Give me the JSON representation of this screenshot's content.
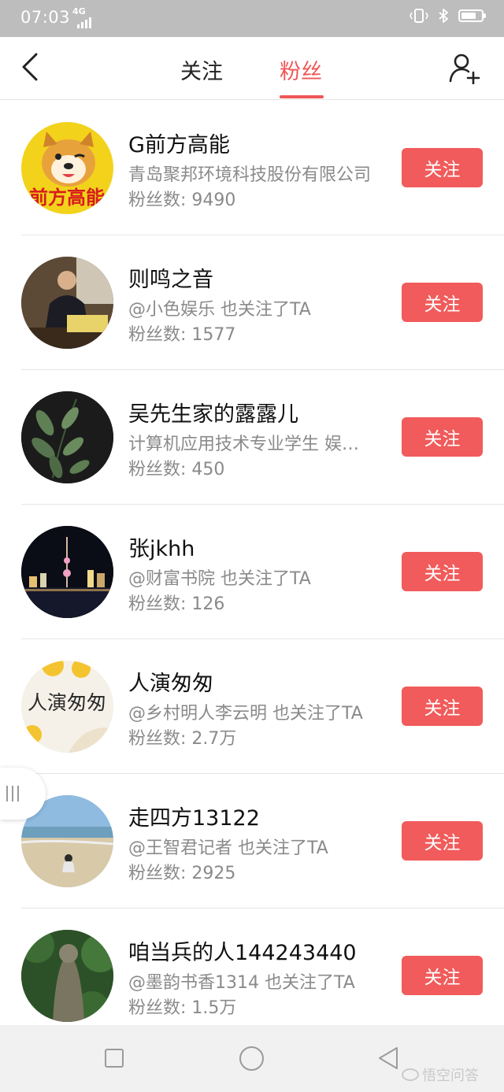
{
  "status": {
    "time": "07:03",
    "network": "4G",
    "battery_level": 0.75
  },
  "header": {
    "tabs": [
      {
        "label": "关注",
        "active": false
      },
      {
        "label": "粉丝",
        "active": true
      }
    ],
    "accent": "#f05656"
  },
  "follow_label": "关注",
  "users": [
    {
      "name": "G前方高能",
      "desc": "青岛聚邦环境科技股份有限公司",
      "fans": "粉丝数: 9490"
    },
    {
      "name": "则鸣之音",
      "desc": "@小色娱乐 也关注了TA",
      "fans": "粉丝数: 1577"
    },
    {
      "name": "吴先生家的露露儿",
      "desc": "计算机应用技术专业学生 娱乐达人",
      "fans": "粉丝数: 450"
    },
    {
      "name": "张jkhh",
      "desc": "@财富书院 也关注了TA",
      "fans": "粉丝数: 126"
    },
    {
      "name": "人演匆匆",
      "desc": "@乡村明人李云明 也关注了TA",
      "fans": "粉丝数: 2.7万"
    },
    {
      "name": "走四方13122",
      "desc": "@王智君记者 也关注了TA",
      "fans": "粉丝数: 2925"
    },
    {
      "name": "咱当兵的人144243440",
      "desc": "@墨韵书香1314 也关注了TA",
      "fans": "粉丝数: 1.5万"
    }
  ],
  "avatar_texts": {
    "a1": "前方高能",
    "a5": "人演匆匆"
  },
  "watermark": "悟空问答"
}
